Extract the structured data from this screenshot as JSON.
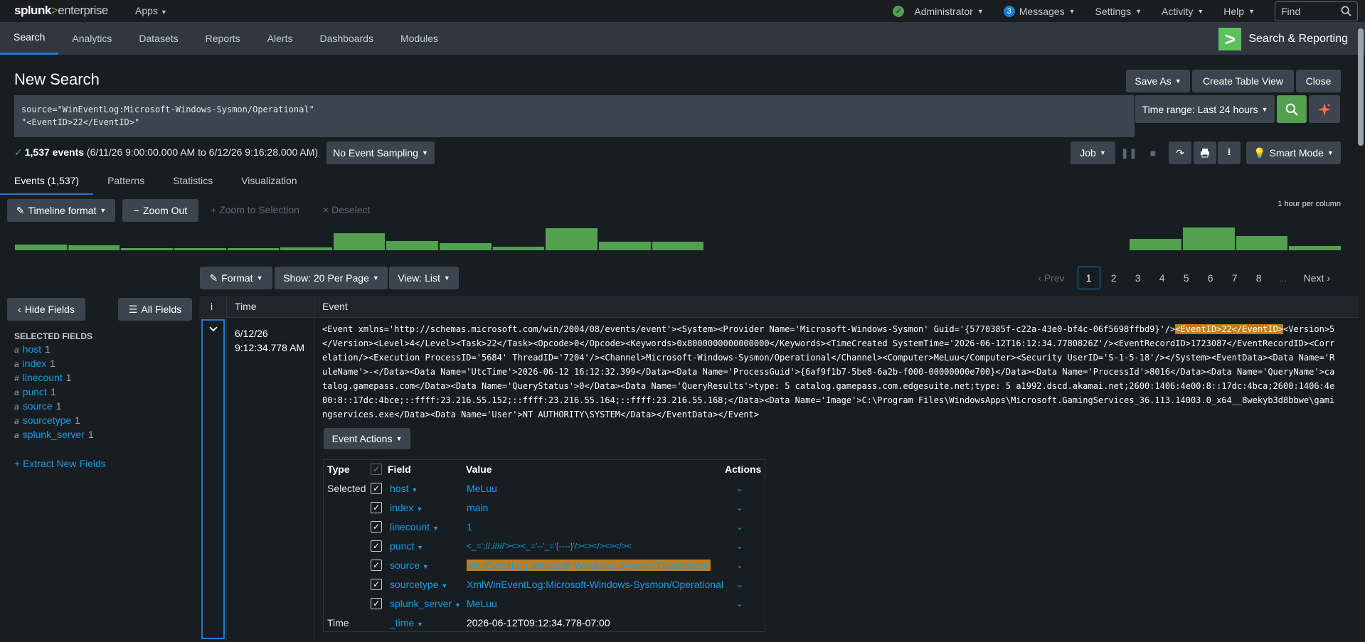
{
  "topbar": {
    "logo_brand": "splunk",
    "logo_sep": ">",
    "logo_product": "enterprise",
    "apps": "Apps",
    "admin": "Administrator",
    "messages_count": "3",
    "messages": "Messages",
    "settings": "Settings",
    "activity": "Activity",
    "help": "Help",
    "find_placeholder": "Find"
  },
  "appbar": {
    "tabs": [
      "Search",
      "Analytics",
      "Datasets",
      "Reports",
      "Alerts",
      "Dashboards",
      "Modules"
    ],
    "active_tab": "Search",
    "app_title": "Search & Reporting"
  },
  "page": {
    "title": "New Search",
    "save_as": "Save As",
    "create_table_view": "Create Table View",
    "close": "Close",
    "query_line1": "source=\"WinEventLog:Microsoft-Windows-Sysmon/Operational\"",
    "query_line2": "\"<EventID>22</EventID>\"",
    "time_range": "Time range: Last 24 hours",
    "results_count": "1,537 events",
    "results_range": "(6/11/26 9:00:00.000 AM to 6/12/26 9:16:28.000 AM)",
    "sampling": "No Event Sampling",
    "job": "Job",
    "smart_mode": "Smart Mode"
  },
  "result_tabs": [
    "Events (1,537)",
    "Patterns",
    "Statistics",
    "Visualization"
  ],
  "timeline": {
    "format": "Timeline format",
    "zoom_out": "Zoom Out",
    "zoom_selection": "Zoom to Selection",
    "deselect": "Deselect",
    "scale": "1 hour per column",
    "bars": [
      0.25,
      0.2,
      0.1,
      0.08,
      0.1,
      0.12,
      0.7,
      0.38,
      0.3,
      0.15,
      0.9,
      0.35,
      0.35,
      0,
      0,
      0,
      0,
      0,
      0,
      0,
      0,
      0.47,
      0.95,
      0.6,
      0.18
    ]
  },
  "listbar": {
    "format": "Format",
    "per_page": "Show: 20 Per Page",
    "view": "View: List",
    "prev": "Prev",
    "pages": [
      "1",
      "2",
      "3",
      "4",
      "5",
      "6",
      "7",
      "8"
    ],
    "ellipsis": "...",
    "next": "Next"
  },
  "sidebar": {
    "hide_fields": "Hide Fields",
    "all_fields": "All Fields",
    "selected_title": "SELECTED FIELDS",
    "fields": [
      {
        "type": "a",
        "name": "host",
        "count": "1"
      },
      {
        "type": "a",
        "name": "index",
        "count": "1"
      },
      {
        "type": "#",
        "name": "linecount",
        "count": "1"
      },
      {
        "type": "a",
        "name": "punct",
        "count": "1"
      },
      {
        "type": "a",
        "name": "source",
        "count": "1"
      },
      {
        "type": "a",
        "name": "sourcetype",
        "count": "1"
      },
      {
        "type": "a",
        "name": "splunk_server",
        "count": "1"
      }
    ],
    "extract": "+ Extract New Fields"
  },
  "events": {
    "col_info": "i",
    "col_time": "Time",
    "col_event": "Event",
    "time_date": "6/12/26",
    "time_clock": "9:12:34.778 AM",
    "raw_before": "<Event xmlns='http://schemas.microsoft.com/win/2004/08/events/event'><System><Provider Name='Microsoft-Windows-Sysmon' Guid='{5770385f-c22a-43e0-bf4c-06f5698ffbd9}'/>",
    "raw_highlight": "<EventID>22</EventID>",
    "raw_after": "<Version>5</Version><Level>4</Level><Task>22</Task><Opcode>0</Opcode><Keywords>0x8000000000000000</Keywords><TimeCreated SystemTime='2026-06-12T16:12:34.7780826Z'/><EventRecordID>1723087</EventRecordID><Correlation/><Execution ProcessID='5684' ThreadID='7204'/><Channel>Microsoft-Windows-Sysmon/Operational</Channel><Computer>MeLuu</Computer><Security UserID='S-1-5-18'/></System><EventData><Data Name='RuleName'>-</Data><Data Name='UtcTime'>2026-06-12 16:12:32.399</Data><Data Name='ProcessGuid'>{6af9f1b7-5be8-6a2b-f000-00000000e700}</Data><Data Name='ProcessId'>8016</Data><Data Name='QueryName'>catalog.gamepass.com</Data><Data Name='QueryStatus'>0</Data><Data Name='QueryResults'>type: 5 catalog.gamepass.com.edgesuite.net;type: 5 a1992.dscd.akamai.net;2600:1406:4e00:8::17dc:4bca;2600:1406:4e00:8::17dc:4bce;::ffff:23.216.55.152;::ffff:23.216.55.164;::ffff:23.216.55.168;</Data><Data Name='Image'>C:\\Program Files\\WindowsApps\\Microsoft.GamingServices_36.113.14003.0_x64__8wekyb3d8bbwe\\gamingservices.exe</Data><Data Name='User'>NT AUTHORITY\\SYSTEM</Data></EventData></Event>",
    "event_actions": "Event Actions"
  },
  "fieldtable": {
    "h_type": "Type",
    "h_field": "Field",
    "h_value": "Value",
    "h_actions": "Actions",
    "selected_label": "Selected",
    "rows": [
      {
        "field": "host",
        "value": "MeLuu"
      },
      {
        "field": "index",
        "value": "main"
      },
      {
        "field": "linecount",
        "value": "1"
      },
      {
        "field": "punct",
        "value": "<_='://./////'><><_='--'_='{----}'/><></><></><"
      },
      {
        "field": "source",
        "value": "WinEventLog:Microsoft-Windows-Sysmon/Operational"
      },
      {
        "field": "sourcetype",
        "value": "XmlWinEventLog:Microsoft-Windows-Sysmon/Operational"
      },
      {
        "field": "splunk_server",
        "value": "MeLuu"
      }
    ],
    "time_label": "Time",
    "time_field": "_time",
    "time_value": "2026-06-12T09:12:34.778-07:00"
  }
}
